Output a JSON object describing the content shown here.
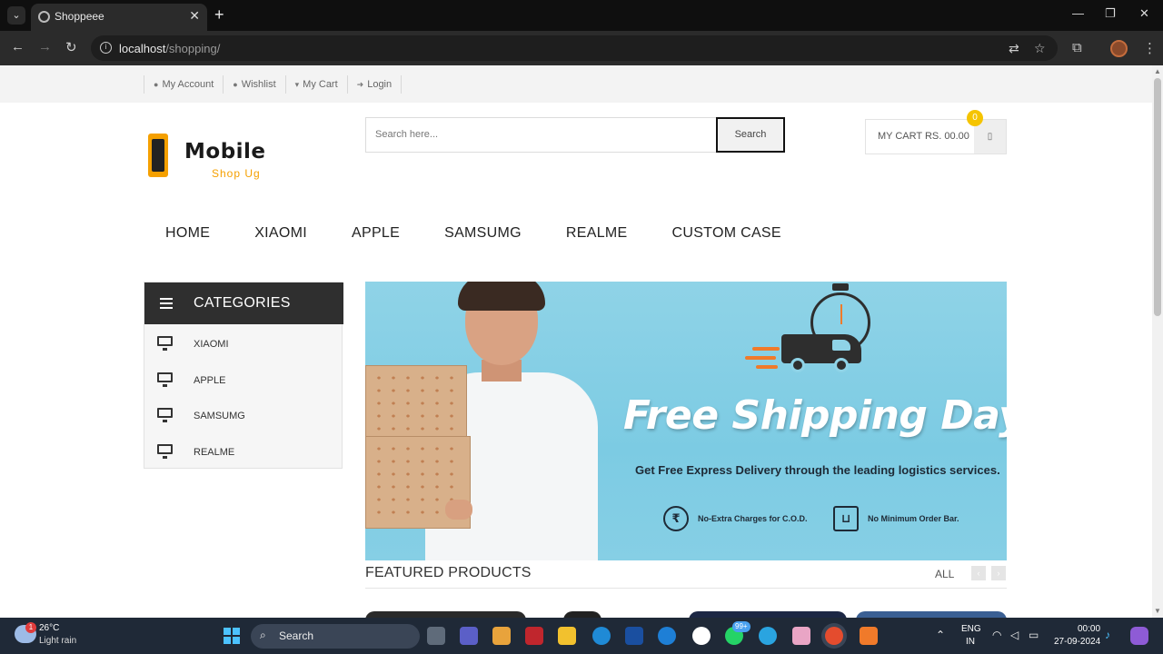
{
  "browser": {
    "tab_title": "Shoppeee",
    "url_host": "localhost",
    "url_path": "/shopping/"
  },
  "top_links": [
    {
      "label": "My Account",
      "icon": "user-icon"
    },
    {
      "label": "Wishlist",
      "icon": "user-icon"
    },
    {
      "label": "My Cart",
      "icon": "cart-icon"
    },
    {
      "label": "Login",
      "icon": "login-icon"
    }
  ],
  "logo": {
    "big": "Mobile",
    "sub": "Shop Ug"
  },
  "search": {
    "placeholder": "Search here...",
    "button": "Search"
  },
  "cart": {
    "label": "MY CART RS. 00.00",
    "count": "0"
  },
  "nav": [
    "HOME",
    "XIAOMI",
    "APPLE",
    "SAMSUMG",
    "REALME",
    "CUSTOM CASE"
  ],
  "categories": {
    "title": "CATEGORIES",
    "items": [
      "XIAOMI",
      "APPLE",
      "SAMSUMG",
      "REALME"
    ]
  },
  "banner": {
    "title": "Free Shipping Days",
    "subtitle": "Get Free Express Delivery through the leading logistics services.",
    "perk1": "No-Extra Charges for C.O.D.",
    "perk2": "No Minimum Order Bar."
  },
  "featured": {
    "title": "FEATURED PRODUCTS",
    "filter": "ALL"
  },
  "taskbar": {
    "weather_temp": "26°C",
    "weather_desc": "Light rain",
    "weather_badge": "1",
    "search_label": "Search",
    "whatsapp_badge": "99+",
    "lang1": "ENG",
    "lang2": "IN",
    "time": "00:00",
    "date": "27-09-2024"
  },
  "colors": {
    "accent": "#f5a000",
    "dark": "#2f2f2f",
    "banner_bg": "#8fd3e7"
  }
}
